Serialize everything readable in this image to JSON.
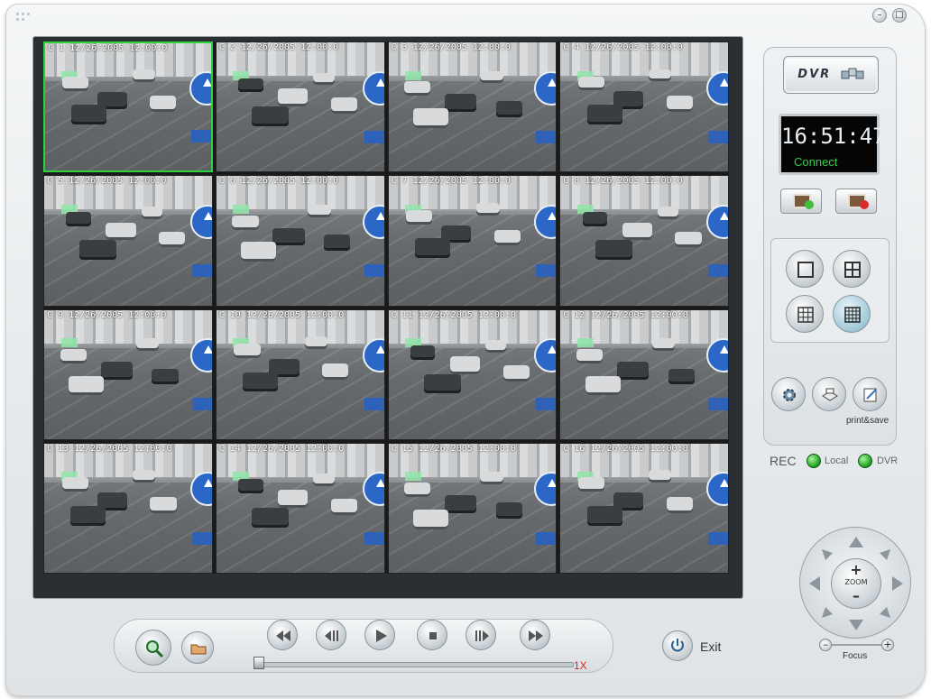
{
  "window": {
    "minimize_label": "–",
    "maximize_label": "□"
  },
  "cameras": [
    {
      "label": "C 1  12/26/2005 12:00:0",
      "active": true
    },
    {
      "label": "C 2  12/26/2005 12:00:0",
      "active": false
    },
    {
      "label": "C 3  12/26/2005 12:00:0",
      "active": false
    },
    {
      "label": "C 4  12/26/2005 12:00:0",
      "active": false
    },
    {
      "label": "C 5  12/26/2005 12:00:0",
      "active": false
    },
    {
      "label": "C 6  12/26/2005 12:00:0",
      "active": false
    },
    {
      "label": "C 7  12/26/2005 12:00:0",
      "active": false
    },
    {
      "label": "C 8  12/26/2005 12:00:0",
      "active": false
    },
    {
      "label": "C 9  12/26/2005 12:00:0",
      "active": false
    },
    {
      "label": "C 10 12/26/2005 12:00:0",
      "active": false
    },
    {
      "label": "C 11 12/26/2005 12:00:0",
      "active": false
    },
    {
      "label": "C 12 12/26/2005 12:00:0",
      "active": false
    },
    {
      "label": "C 13 12/26/2005 12:00:0",
      "active": false
    },
    {
      "label": "C 14 12/26/2005 12:00:0",
      "active": false
    },
    {
      "label": "C 15 12/26/2005 12:00:0",
      "active": false
    },
    {
      "label": "C 16 12/26/2005 12:00:0",
      "active": false
    }
  ],
  "side": {
    "dvr_label": "DVR",
    "clock_time": "16:51:47",
    "connection_status": "Connect",
    "print_save_label": "print&save"
  },
  "rec": {
    "label": "REC",
    "local_label": "Local",
    "dvr_label": "DVR"
  },
  "ptz": {
    "zoom_label": "ZOOM",
    "zoom_in": "+",
    "zoom_out": "–",
    "focus_label": "Focus",
    "focus_minus": "–",
    "focus_plus": "+"
  },
  "playback": {
    "speed": "1X",
    "exit_label": "Exit"
  },
  "colors": {
    "active_border": "#2fd23a",
    "connect_text": "#31d04a",
    "speed_text": "#e0241c",
    "led_green": "#22a524"
  }
}
